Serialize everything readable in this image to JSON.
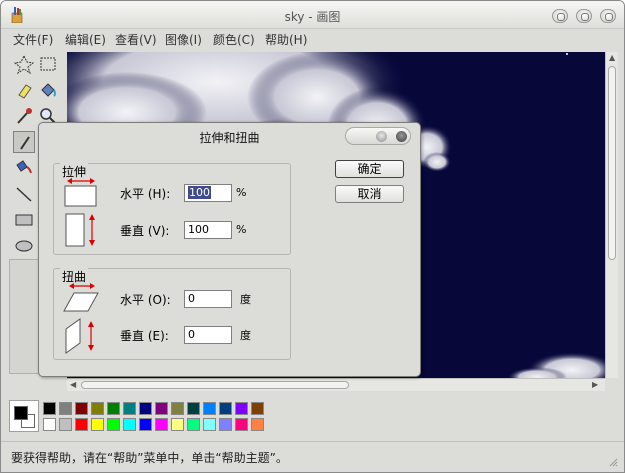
{
  "window": {
    "title": "sky - 画图"
  },
  "menu": [
    "文件(F)",
    "编辑(E)",
    "查看(V)",
    "图像(I)",
    "颜色(C)",
    "帮助(H)"
  ],
  "dialog": {
    "title": "拉伸和扭曲",
    "stretch": {
      "label": "拉伸",
      "horizontal_label": "水平 (H):",
      "horizontal_value": "100",
      "vertical_label": "垂直 (V):",
      "vertical_value": "100",
      "unit": "%"
    },
    "skew": {
      "label": "扭曲",
      "horizontal_label": "水平 (O):",
      "horizontal_value": "0",
      "vertical_label": "垂直 (E):",
      "vertical_value": "0",
      "unit": "度"
    },
    "ok": "确定",
    "cancel": "取消"
  },
  "palette_colors": [
    "#000000",
    "#808080",
    "#800000",
    "#808000",
    "#008000",
    "#008080",
    "#000080",
    "#800080",
    "#808040",
    "#004040",
    "#0080ff",
    "#004080",
    "#8000ff",
    "#804000",
    "#ffffff",
    "#c0c0c0",
    "#ff0000",
    "#ffff00",
    "#00ff00",
    "#00ffff",
    "#0000ff",
    "#ff00ff",
    "#ffff80",
    "#00ff80",
    "#80ffff",
    "#8080ff",
    "#ff0080",
    "#ff8040"
  ],
  "status": "要获得帮助，请在“帮助”菜单中，单击“帮助主题”。"
}
